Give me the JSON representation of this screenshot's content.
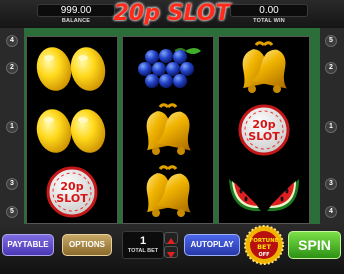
{
  "header": {
    "balance_value": "999.00",
    "balance_label": "BALANCE",
    "title": "20p SLOT",
    "total_win_value": "0.00",
    "total_win_label": "TOTAL WIN"
  },
  "paylines": {
    "left": [
      "4",
      "2",
      "1",
      "3",
      "5"
    ],
    "right": [
      "5",
      "2",
      "1",
      "3",
      "4"
    ]
  },
  "reels": [
    [
      "lemon",
      "lemon",
      "20p-slot"
    ],
    [
      "blueberries",
      "bells",
      "bells"
    ],
    [
      "bells",
      "20p-slot",
      "watermelon"
    ]
  ],
  "symbol_text": {
    "logo_line1": "20p",
    "logo_line2": "SLOT"
  },
  "controls": {
    "paytable_label": "PAYTABLE",
    "options_label": "OPTIONS",
    "total_bet_value": "1",
    "total_bet_label": "TOTAL BET",
    "autoplay_label": "AUTOPLAY",
    "fortune_bet_line1": "FORTUNE",
    "fortune_bet_line2": "BET",
    "fortune_bet_state": "OFF",
    "spin_label": "SPIN"
  },
  "colors": {
    "title": "#ff2a1a",
    "reel_background": "#000000",
    "felt_green": "#2b6e3a",
    "paytable_button": "#5a47c8",
    "options_button": "#a8864a",
    "autoplay_button": "#3a52d8",
    "spin_button": "#4cb82a"
  }
}
